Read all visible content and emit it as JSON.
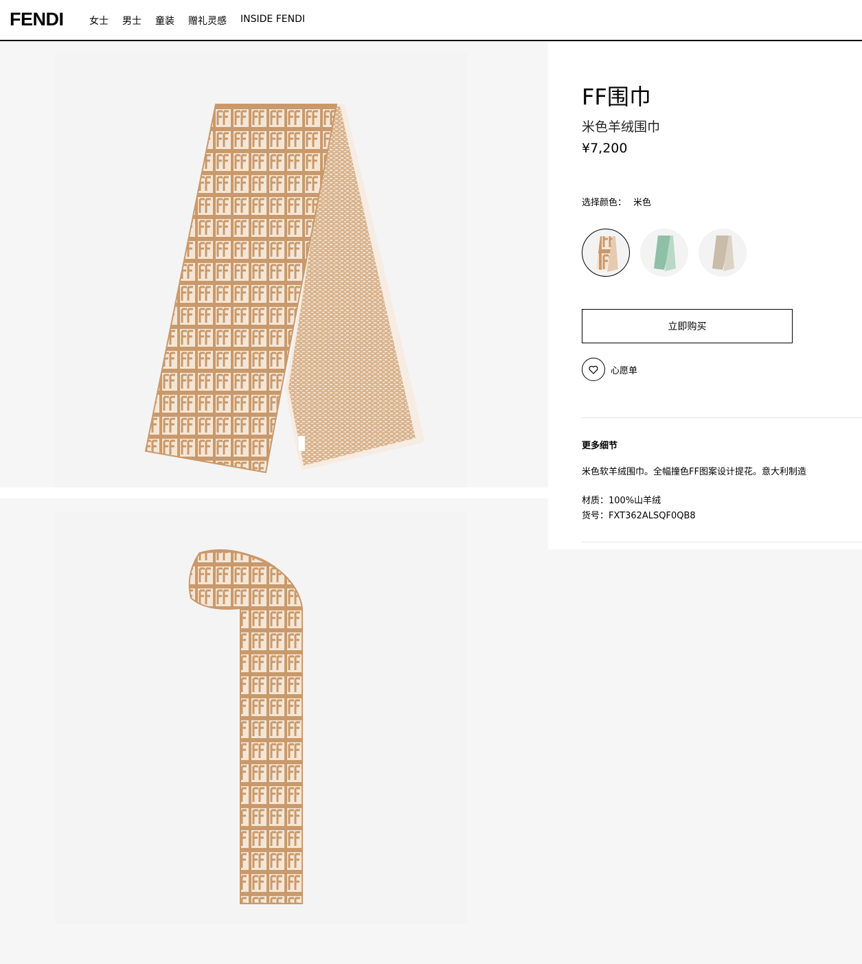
{
  "brand": {
    "logo": "FENDI"
  },
  "nav": {
    "items": [
      "女士",
      "男士",
      "童装",
      "赠礼灵感",
      "INSIDE FENDI"
    ]
  },
  "product": {
    "title": "FF围巾",
    "subtitle": "米色羊绒围巾",
    "price": "¥7,200",
    "color_label": "选择颜色：",
    "color_value": "米色",
    "swatches": [
      {
        "name": "beige",
        "color": "#d4a57a",
        "selected": true
      },
      {
        "name": "mint",
        "color": "#8fbfa6",
        "selected": false
      },
      {
        "name": "taupe",
        "color": "#c9bca8",
        "selected": false
      }
    ],
    "buy_label": "立即购买",
    "wishlist_label": "心愿单"
  },
  "details": {
    "heading": "更多细节",
    "description": "米色软羊绒围巾。全幅撞色FF图案设计提花。意大利制造",
    "material": "材质：100%山羊绒",
    "sku": "货号：FXT362ALSQF0QB8"
  },
  "colors": {
    "camel": "#c9996b",
    "cream": "#f5e9dd",
    "background": "#f6f6f6"
  }
}
